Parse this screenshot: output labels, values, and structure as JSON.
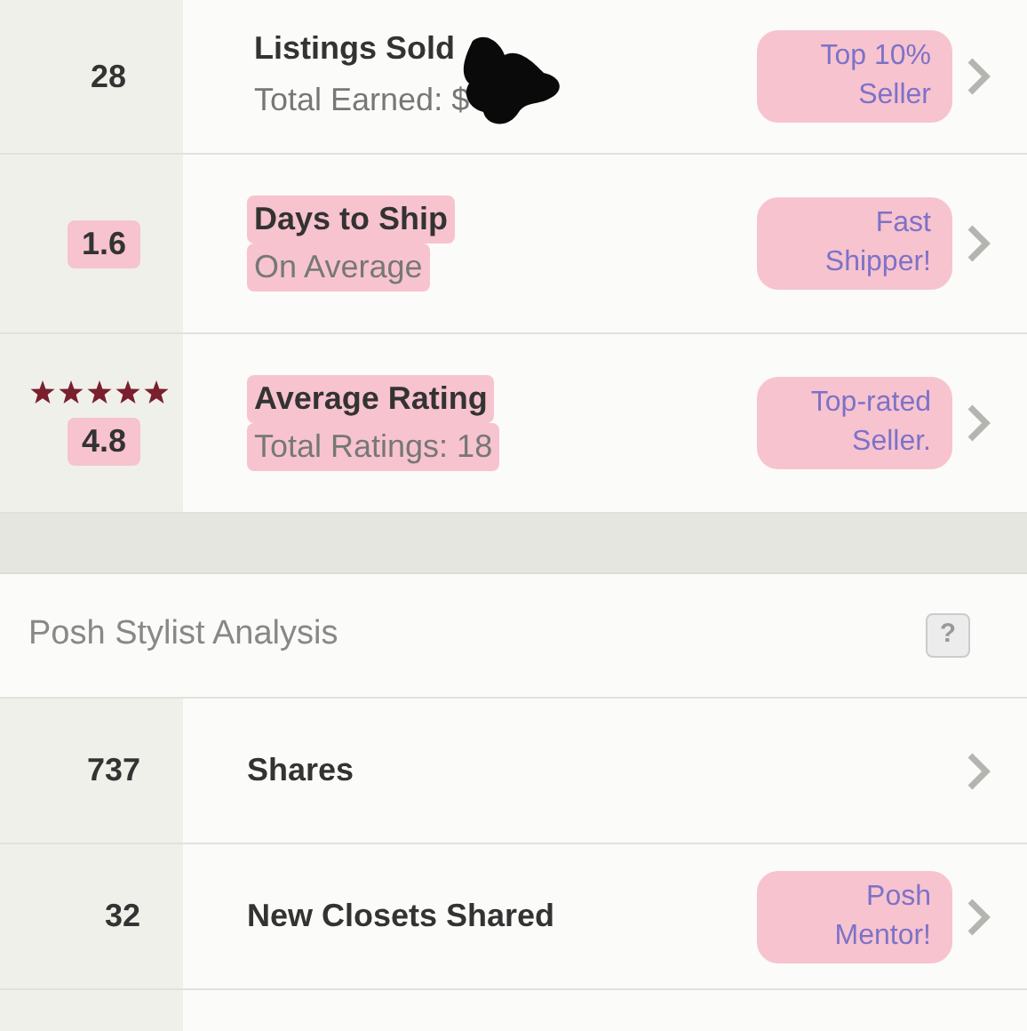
{
  "seller_stats": [
    {
      "value": "28",
      "title": "Listings Sold",
      "subtitle": "Total Earned: $",
      "redacted": true,
      "title_highlighted": false,
      "value_highlighted": false,
      "badge": [
        "Top 10%",
        "Seller"
      ],
      "badge_highlighted": true
    },
    {
      "value": "1.6",
      "title": "Days to Ship",
      "subtitle": "On Average",
      "redacted": false,
      "title_highlighted": true,
      "value_highlighted": true,
      "badge": [
        "Fast",
        "Shipper!"
      ],
      "badge_highlighted": true
    },
    {
      "value": "4.8",
      "stars": 5,
      "title": "Average Rating",
      "subtitle": "Total Ratings: 18",
      "redacted": false,
      "title_highlighted": true,
      "value_highlighted": true,
      "badge": [
        "Top-rated",
        "Seller."
      ],
      "badge_highlighted": true
    }
  ],
  "stylist_section": {
    "title": "Posh Stylist Analysis",
    "help": "?"
  },
  "stylist_stats": [
    {
      "value": "737",
      "title": "Shares"
    },
    {
      "value": "32",
      "title": "New Closets Shared",
      "badge": [
        "Posh",
        "Mentor!"
      ],
      "badge_highlighted": true
    }
  ]
}
